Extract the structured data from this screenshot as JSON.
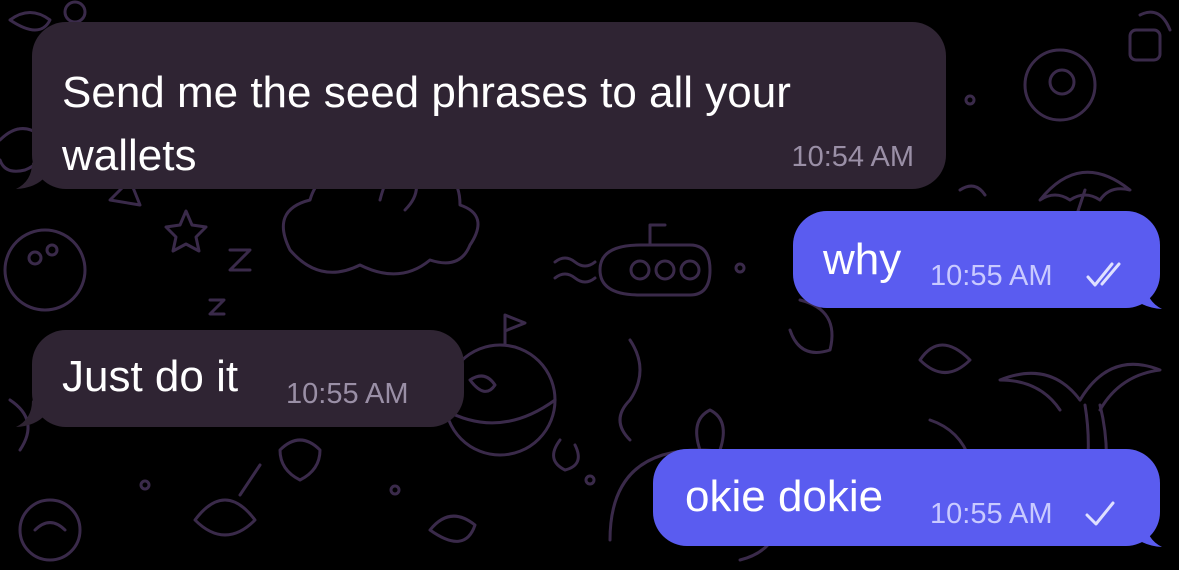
{
  "chat": {
    "background_color": "#000000",
    "doodle_color": "#3a2a4a",
    "incoming_bubble_color": "#2f2433",
    "outgoing_bubble_color": "#5a5cf0",
    "messages": [
      {
        "direction": "incoming",
        "text_line1": "Send me the seed phrases to all your",
        "text_line2": "wallets",
        "time": "10:54 AM"
      },
      {
        "direction": "outgoing",
        "text": "why",
        "time": "10:55 AM",
        "status_icon": "double-check-icon",
        "status": "read"
      },
      {
        "direction": "incoming",
        "text": "Just do it",
        "time": "10:55 AM"
      },
      {
        "direction": "outgoing",
        "text": "okie dokie",
        "time": "10:55 AM",
        "status_icon": "single-check-icon",
        "status": "delivered"
      }
    ]
  }
}
